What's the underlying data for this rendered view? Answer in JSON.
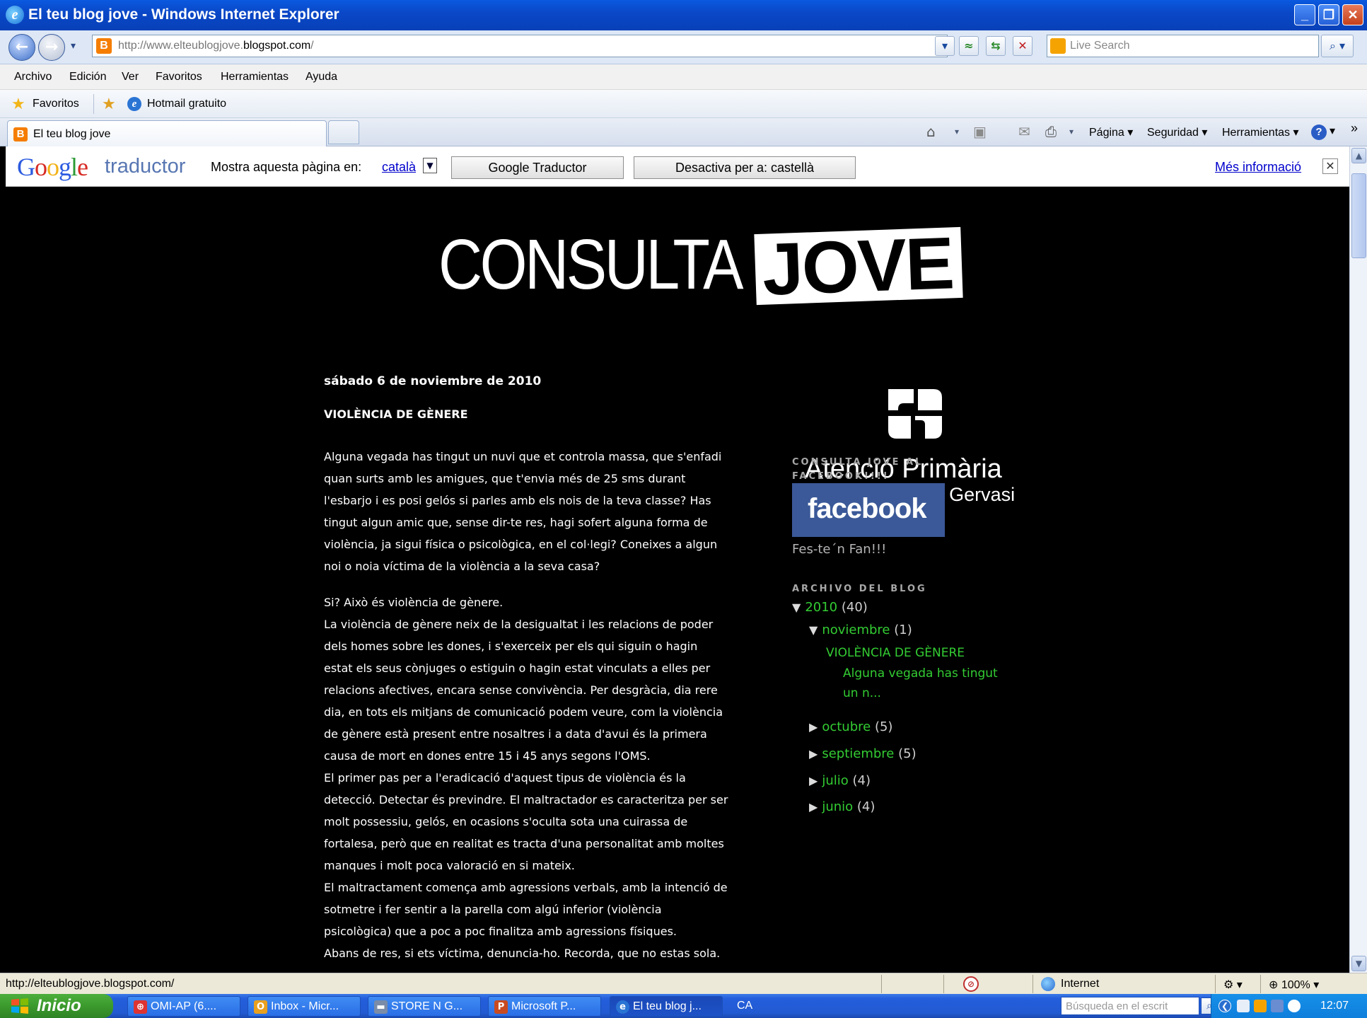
{
  "window": {
    "title": "El teu blog jove - Windows Internet Explorer",
    "controls": {
      "minimize": "_",
      "maximize": "❐",
      "close": "✕"
    }
  },
  "address_bar": {
    "url_prefix": "http://www.elteublogjove.",
    "url_domain": "blogspot.com",
    "url_suffix": "/",
    "search_placeholder": "Live Search"
  },
  "menu": [
    "Archivo",
    "Edición",
    "Ver",
    "Favoritos",
    "Herramientas",
    "Ayuda"
  ],
  "favorites_bar": {
    "favorites_label": "Favoritos",
    "hotmail_link": "Hotmail gratuito"
  },
  "tabs": [
    {
      "label": "El teu blog jove"
    }
  ],
  "command_bar": {
    "page": "Página",
    "security": "Seguridad",
    "tools": "Herramientas",
    "overflow": "»"
  },
  "translate_bar": {
    "logo_word": "Google",
    "product": "traductor",
    "show_page_in": "Mostra aquesta pàgina en:",
    "language": "català",
    "translate_button": "Google Traductor",
    "disable_button": "Desactiva per a: castellà",
    "more_info": "Més informació",
    "close": "✕"
  },
  "blog": {
    "logo_left": "CONSULTA",
    "logo_right": "JOVE",
    "post_date": "sábado 6 de noviembre de 2010",
    "post_title": "VIOLÈNCIA DE GÈNERE",
    "paragraph1": [
      "Alguna vegada has tingut un nuvi que et controla massa, que s'enfadi",
      "quan surts amb les amigues, que t'envia més de 25 sms durant",
      "l'esbarjo i es posi gelós si parles amb els nois de la teva classe? Has",
      "tingut algun amic que, sense dir-te res, hagi sofert alguna forma de",
      "violència, ja sigui física o psicològica, en el col·legi? Coneixes a algun",
      "noi o noia víctima de la violència a la seva casa?"
    ],
    "paragraph2": [
      "Si? Això és violència de gènere.",
      "La violència de gènere neix de la desigualtat i les relacions de poder",
      "dels homes sobre les dones, i s'exerceix per els qui siguin o hagin",
      "estat els seus cònjuges o estiguin o hagin estat vinculats a elles per",
      "relacions afectives, encara sense convivència. Per desgràcia, dia rere",
      "dia, en tots els mitjans de comunicació podem veure, com la violència",
      "de gènere està present entre nosaltres i a data d'avui és la primera",
      "causa de mort en dones entre 15 i 45 anys segons l'OMS.",
      "El primer pas per a l'eradicació d'aquest tipus de violència és la",
      "detecció. Detectar és previndre. El maltractador es caracteritza per ser",
      "molt possessiu, gelós, en ocasions s'oculta sota una cuirassa de",
      "fortalesa, però que en realitat es tracta d'una personalitat amb moltes",
      "manques i molt poca valoració en si mateix.",
      "El maltractament comença amb agressions verbals, amb la intenció de",
      "sotmetre i fer sentir a la parella com algú inferior (violència",
      "psicològica) que a poc a poc finalitza amb agressions físiques.",
      "Abans de res, si ets víctima, denuncia-ho. Recorda, que no estas sola."
    ],
    "sidebar": {
      "ap_name1": "Atenció Primària",
      "ap_name2": "Vallcarca – Sant Gervasi",
      "fb_heading_line1": "CONSULTA JOVE AL",
      "fb_heading_line2": "FACEBOOK!!!!",
      "fb_badge": "facebook",
      "fb_fan": "Fes-te´n Fan!!!",
      "archive_heading": "ARCHIVO DEL BLOG",
      "archive": {
        "year": {
          "label": "2010",
          "count": "(40)"
        },
        "month_open": {
          "label": "noviembre",
          "count": "(1)"
        },
        "post_title": "VIOLÈNCIA DE GÈNERE",
        "post_snippet_1": "Alguna vegada has tingut",
        "post_snippet_2": "un n...",
        "months": [
          {
            "label": "octubre",
            "count": "(5)"
          },
          {
            "label": "septiembre",
            "count": "(5)"
          },
          {
            "label": "julio",
            "count": "(4)"
          },
          {
            "label": "junio",
            "count": "(4)"
          }
        ]
      }
    }
  },
  "status_bar": {
    "url": "http://elteublogjove.blogspot.com/",
    "zone": "Internet",
    "zoom": "100%"
  },
  "taskbar": {
    "start": "Inicio",
    "tasks": [
      "OMI-AP (6....",
      "Inbox - Micr...",
      "STORE N G...",
      "Microsoft P...",
      "El teu blog j..."
    ],
    "lang": "CA",
    "search_placeholder": "Búsqueda en el escrit",
    "clock": "12:07"
  }
}
